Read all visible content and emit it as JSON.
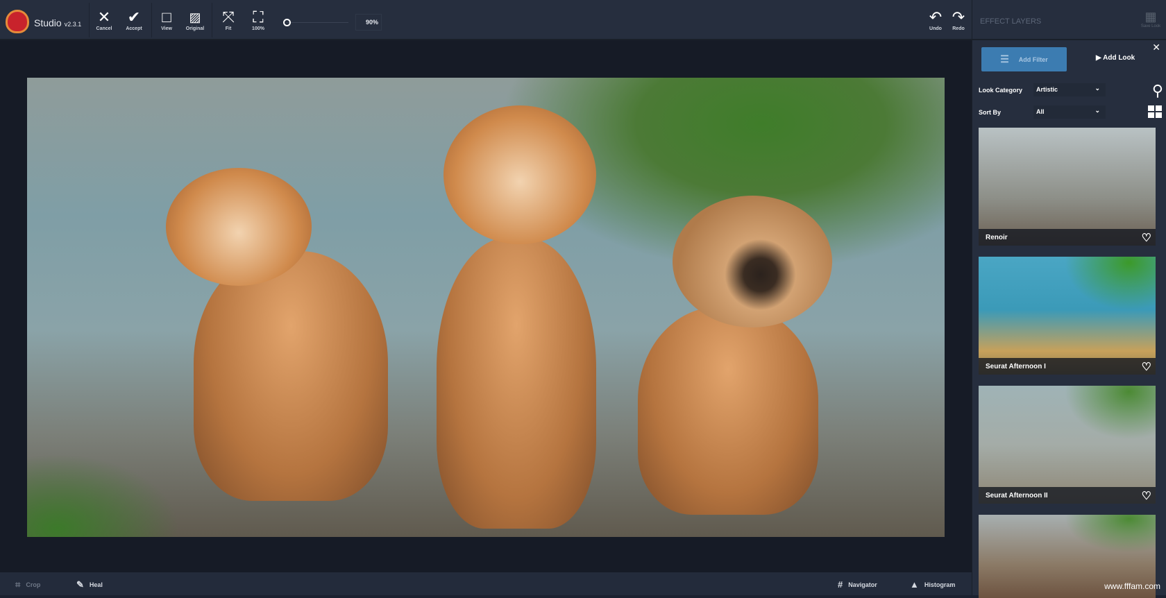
{
  "app": {
    "name": "Studio",
    "version": "v2.3.1"
  },
  "toolbar": {
    "cancel": "Cancel",
    "accept": "Accept",
    "view": "View",
    "original": "Original",
    "fit": "Fit",
    "full": "100%",
    "zoom": "90%",
    "undo": "Undo",
    "redo": "Redo"
  },
  "panel": {
    "title": "EFFECT LAYERS",
    "save_look": "Save Look",
    "add_filter": "Add Filter",
    "add_look": "Add Look",
    "look_category_label": "Look Category",
    "look_category": "Artistic",
    "sort_by_label": "Sort By",
    "sort_by": "All",
    "looks": [
      {
        "name": "Renoir"
      },
      {
        "name": "Seurat Afternoon I"
      },
      {
        "name": "Seurat Afternoon II"
      },
      {
        "name": ""
      }
    ]
  },
  "bottom": {
    "crop": "Crop",
    "heal": "Heal",
    "navigator": "Navigator",
    "histogram": "Histogram"
  },
  "watermark": "www.fffam.com",
  "colors": {
    "accent": "#3c7cb1",
    "bg": "#262e3e"
  }
}
